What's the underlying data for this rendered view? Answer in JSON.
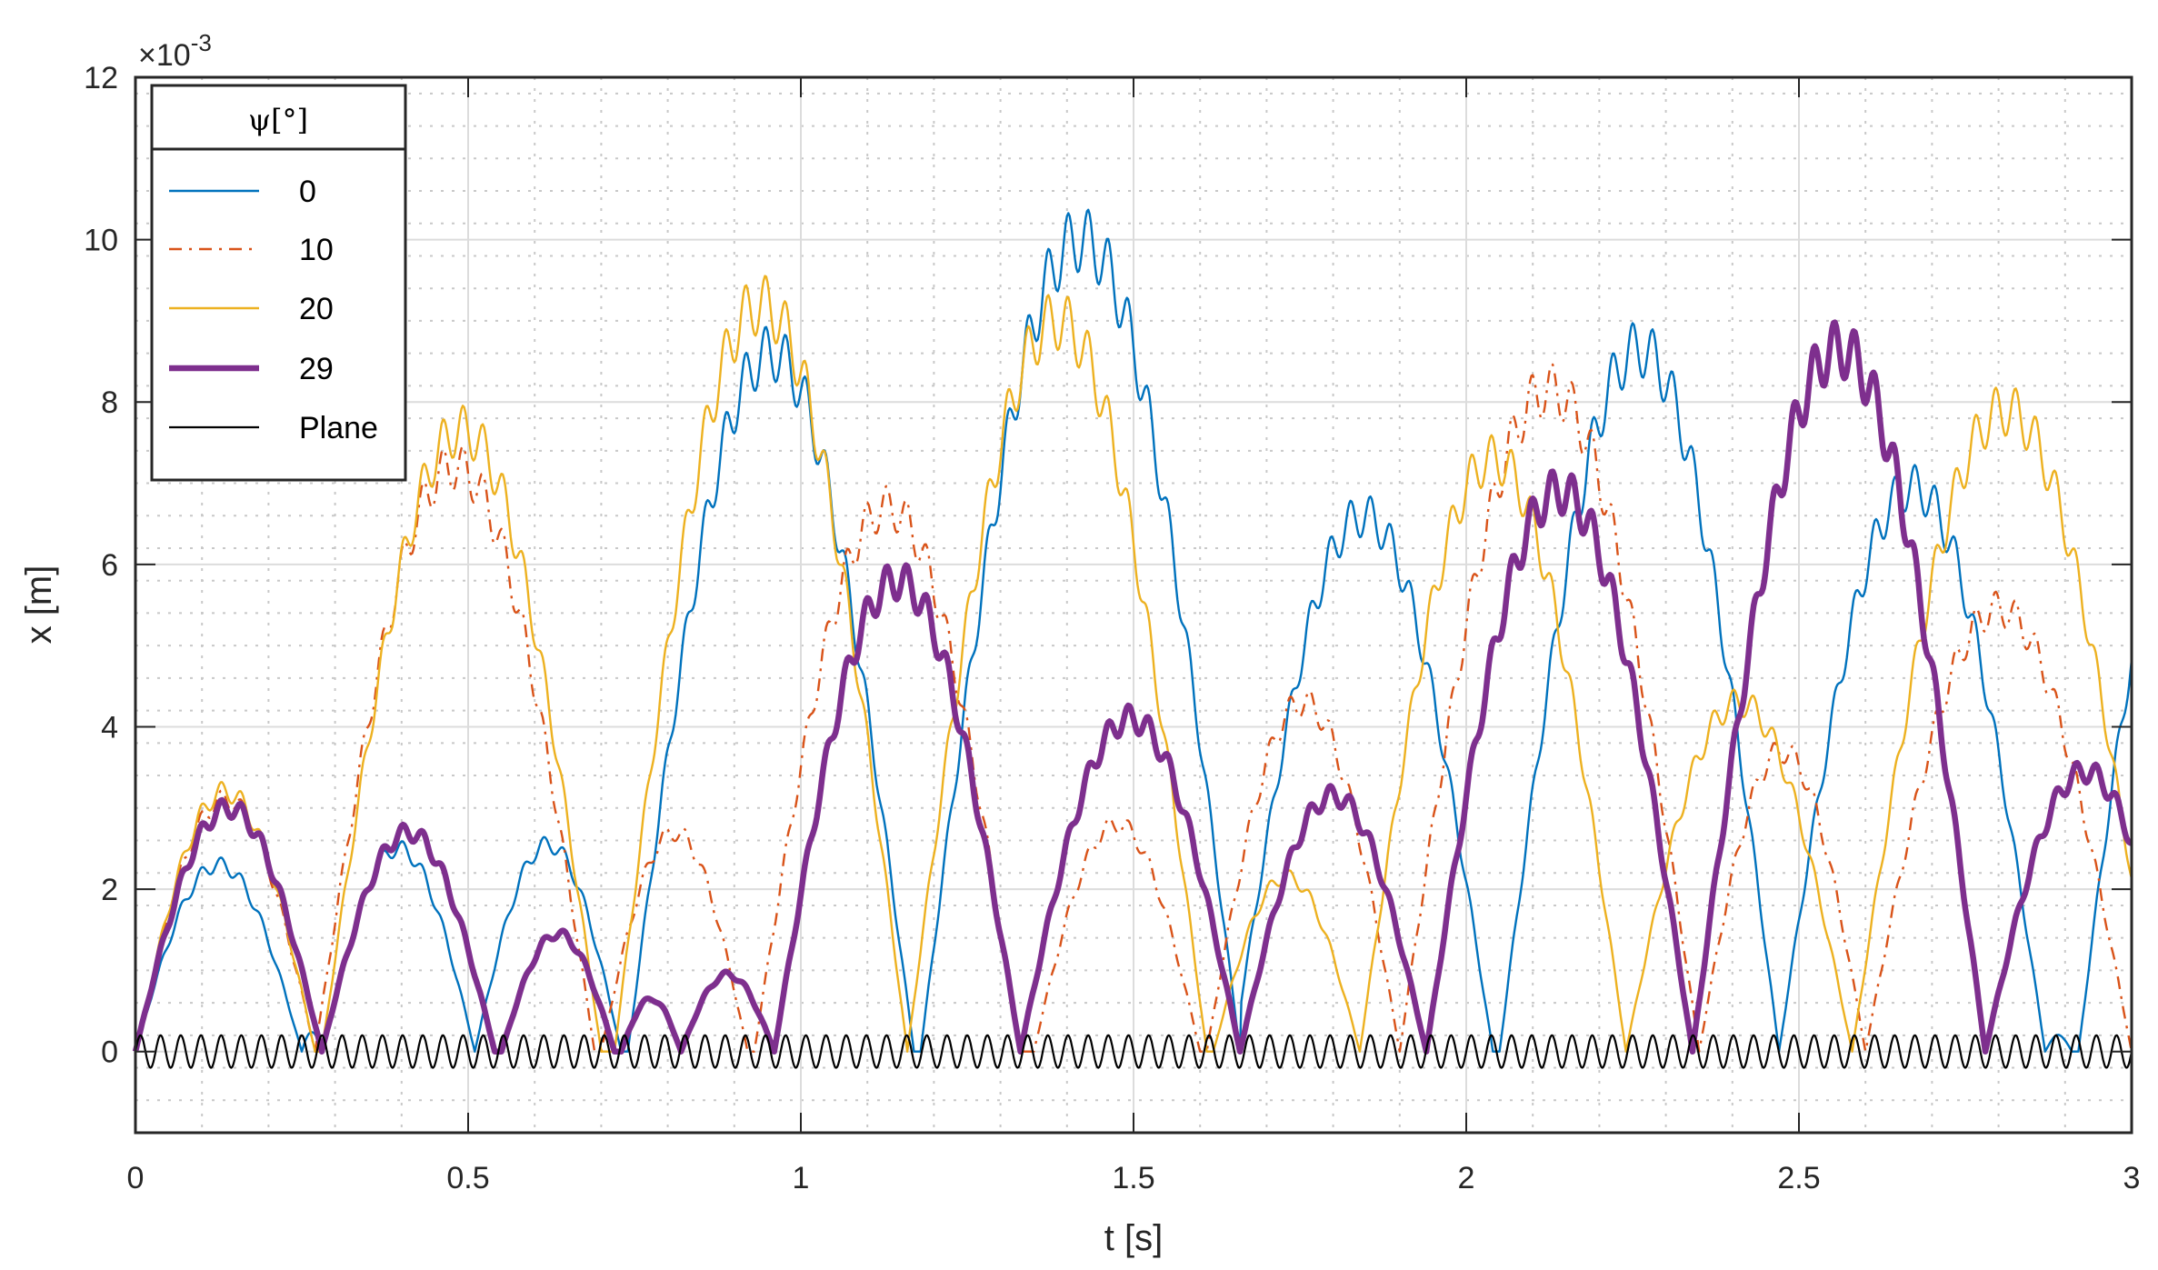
{
  "chart_data": {
    "type": "line",
    "xlabel": "t [s]",
    "ylabel": "x [m]",
    "y_exponent_label": "×10",
    "y_exponent_power": "-3",
    "xlim": [
      0,
      3
    ],
    "ylim": [
      -1,
      12
    ],
    "y_scale_note": "values in units of 1e-3 m",
    "x_ticks": [
      "0",
      "0.5",
      "1",
      "1.5",
      "2",
      "2.5",
      "3"
    ],
    "x_tick_values": [
      0,
      0.5,
      1,
      1.5,
      2,
      2.5,
      3
    ],
    "y_ticks": [
      "0",
      "2",
      "4",
      "6",
      "8",
      "10",
      "12"
    ],
    "y_tick_values": [
      0,
      2,
      4,
      6,
      8,
      10,
      12
    ],
    "grid": {
      "major": true,
      "minor": true,
      "x_minor_step": 0.1,
      "y_minor_step": 0.4
    },
    "legend": {
      "title": "ψ[°]",
      "placement": "top-left",
      "entries": [
        "0",
        "10",
        "20",
        "29",
        "Plane"
      ]
    },
    "series": [
      {
        "name": "0",
        "color": "#0072BD",
        "style": "solid",
        "weight": "thin",
        "arcs": [
          [
            0,
            0.25,
            2.3
          ],
          [
            0.25,
            0.28,
            0.25
          ],
          [
            0.28,
            0.51,
            2.5
          ],
          [
            0.51,
            0.73,
            2.55
          ],
          [
            0.74,
            1.17,
            8.6
          ],
          [
            1.18,
            1.66,
            10.0
          ],
          [
            1.65,
            2.04,
            6.6
          ],
          [
            2.05,
            2.47,
            8.65
          ],
          [
            2.47,
            2.87,
            6.95
          ],
          [
            2.87,
            2.91,
            0.2
          ],
          [
            2.92,
            3.25,
            7.0
          ]
        ]
      },
      {
        "name": "10",
        "color": "#D95319",
        "style": "dashdot",
        "weight": "thin",
        "arcs": [
          [
            0,
            0.27,
            3.1
          ],
          [
            0.27,
            0.69,
            7.2
          ],
          [
            0.7,
            0.92,
            2.7
          ],
          [
            0.93,
            1.33,
            6.7
          ],
          [
            1.35,
            1.6,
            2.8
          ],
          [
            1.61,
            1.9,
            4.3
          ],
          [
            1.9,
            2.35,
            8.15
          ],
          [
            2.35,
            2.6,
            3.7
          ],
          [
            2.6,
            3.0,
            5.45
          ]
        ]
      },
      {
        "name": "20",
        "color": "#EDB120",
        "style": "solid",
        "weight": "thin",
        "arcs": [
          [
            0,
            0.27,
            3.2
          ],
          [
            0.28,
            0.7,
            7.65
          ],
          [
            0.72,
            1.16,
            9.2
          ],
          [
            1.16,
            1.61,
            9.0
          ],
          [
            1.62,
            1.84,
            2.15
          ],
          [
            1.84,
            2.24,
            7.3
          ],
          [
            2.24,
            2.58,
            4.3
          ],
          [
            2.58,
            3.04,
            7.9
          ]
        ]
      },
      {
        "name": "29",
        "color": "#7E2F8E",
        "style": "solid",
        "weight": "thick",
        "arcs": [
          [
            0,
            0.28,
            3.0
          ],
          [
            0.28,
            0.54,
            2.7
          ],
          [
            0.55,
            0.72,
            1.45
          ],
          [
            0.73,
            0.82,
            0.65
          ],
          [
            0.82,
            0.96,
            0.95
          ],
          [
            0.96,
            1.33,
            5.8
          ],
          [
            1.33,
            1.66,
            4.1
          ],
          [
            1.66,
            1.94,
            3.15
          ],
          [
            1.94,
            2.34,
            6.9
          ],
          [
            2.34,
            2.78,
            8.65
          ],
          [
            2.78,
            3.08,
            3.45
          ]
        ]
      },
      {
        "name": "Plane",
        "color": "#000000",
        "style": "solid",
        "weight": "thin",
        "sine": {
          "amplitude": 0.2,
          "frequency_hz": 33
        }
      }
    ]
  }
}
